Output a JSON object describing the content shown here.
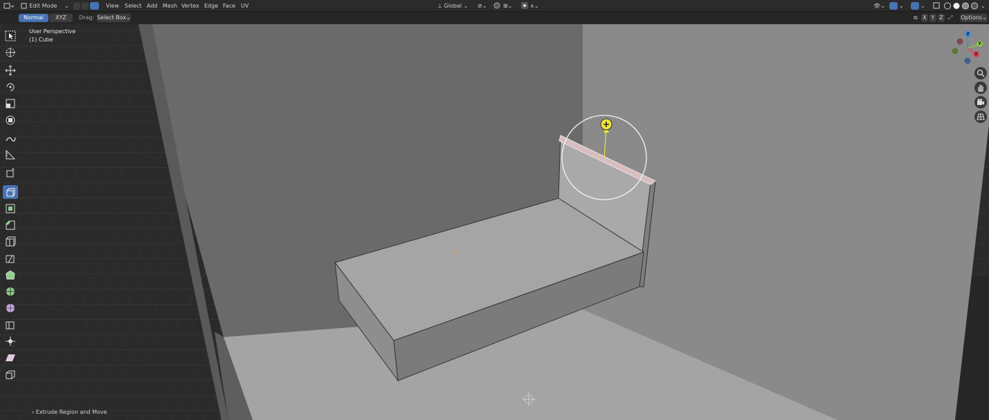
{
  "header": {
    "mode": "Edit Mode",
    "menu": [
      "View",
      "Select",
      "Add",
      "Mesh",
      "Vertex",
      "Edge",
      "Face",
      "UV"
    ],
    "transform_orientation": "Global",
    "options_label": "Options"
  },
  "tool_settings": {
    "orientation_normal": "Normal",
    "orientation_xyz": "XYZ",
    "drag_label": "Drag:",
    "drag_value": "Select Box"
  },
  "axis_toggles": [
    "X",
    "Y",
    "Z"
  ],
  "viewport": {
    "view_name": "User Perspective",
    "object_name": "(1) Cube"
  },
  "gizmo": {
    "x": "X",
    "y": "Y",
    "z": "Z"
  },
  "last_operator": "Extrude Region and Move",
  "colors": {
    "accent": "#4772b3",
    "gizmo_x": "#e04250",
    "gizmo_y": "#8bc53f",
    "gizmo_z": "#3b8ee8",
    "extrude_handle": "#eee53a"
  },
  "toolbar_icons": [
    "select-box-icon",
    "cursor-icon",
    "move-icon",
    "rotate-icon",
    "scale-icon",
    "transform-icon",
    "annotate-icon",
    "measure-icon",
    "add-cube-icon",
    "extrude-region-icon",
    "inset-faces-icon",
    "bevel-icon",
    "loop-cut-icon",
    "knife-icon",
    "poly-build-icon",
    "spin-icon",
    "smooth-icon",
    "edge-slide-icon",
    "shrink-fatten-icon",
    "shear-icon",
    "rip-region-icon"
  ]
}
